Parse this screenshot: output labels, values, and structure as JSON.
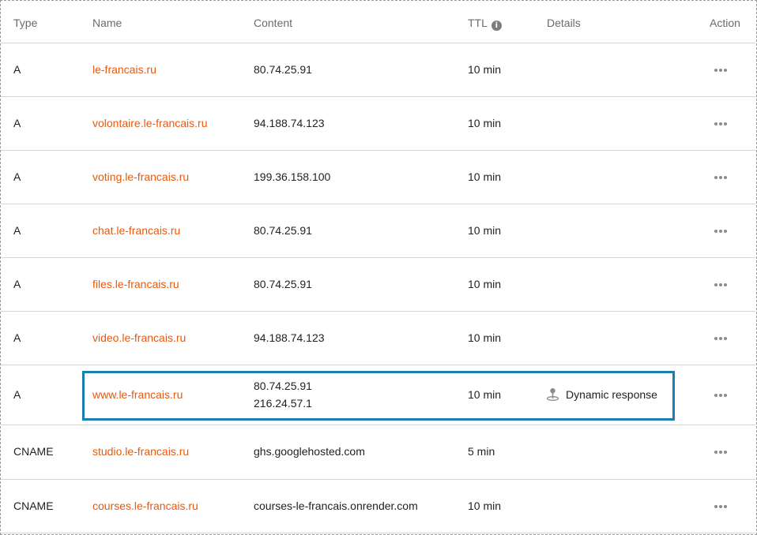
{
  "header": {
    "type": "Type",
    "name": "Name",
    "content": "Content",
    "ttl": "TTL",
    "ttl_info_icon": "i",
    "details": "Details",
    "action": "Action"
  },
  "colors": {
    "name_link": "#e8590c",
    "highlight_border": "#1a7fb0"
  },
  "records": [
    {
      "type": "A",
      "name": "le-francais.ru",
      "content": [
        "80.74.25.91"
      ],
      "ttl": "10 min",
      "details": ""
    },
    {
      "type": "A",
      "name": "volontaire.le-francais.ru",
      "content": [
        "94.188.74.123"
      ],
      "ttl": "10 min",
      "details": ""
    },
    {
      "type": "A",
      "name": "voting.le-francais.ru",
      "content": [
        "199.36.158.100"
      ],
      "ttl": "10 min",
      "details": ""
    },
    {
      "type": "A",
      "name": "chat.le-francais.ru",
      "content": [
        "80.74.25.91"
      ],
      "ttl": "10 min",
      "details": ""
    },
    {
      "type": "A",
      "name": "files.le-francais.ru",
      "content": [
        "80.74.25.91"
      ],
      "ttl": "10 min",
      "details": ""
    },
    {
      "type": "A",
      "name": "video.le-francais.ru",
      "content": [
        "94.188.74.123"
      ],
      "ttl": "10 min",
      "details": ""
    },
    {
      "type": "A",
      "name": "www.le-francais.ru",
      "content": [
        "80.74.25.91",
        "216.24.57.1"
      ],
      "ttl": "10 min",
      "details": "Dynamic response",
      "details_icon": "location-pin-icon",
      "highlighted": true
    },
    {
      "type": "CNAME",
      "name": "studio.le-francais.ru",
      "content": [
        "ghs.googlehosted.com"
      ],
      "ttl": "5 min",
      "details": ""
    },
    {
      "type": "CNAME",
      "name": "courses.le-francais.ru",
      "content": [
        "courses-le-francais.onrender.com"
      ],
      "ttl": "10 min",
      "details": ""
    }
  ]
}
